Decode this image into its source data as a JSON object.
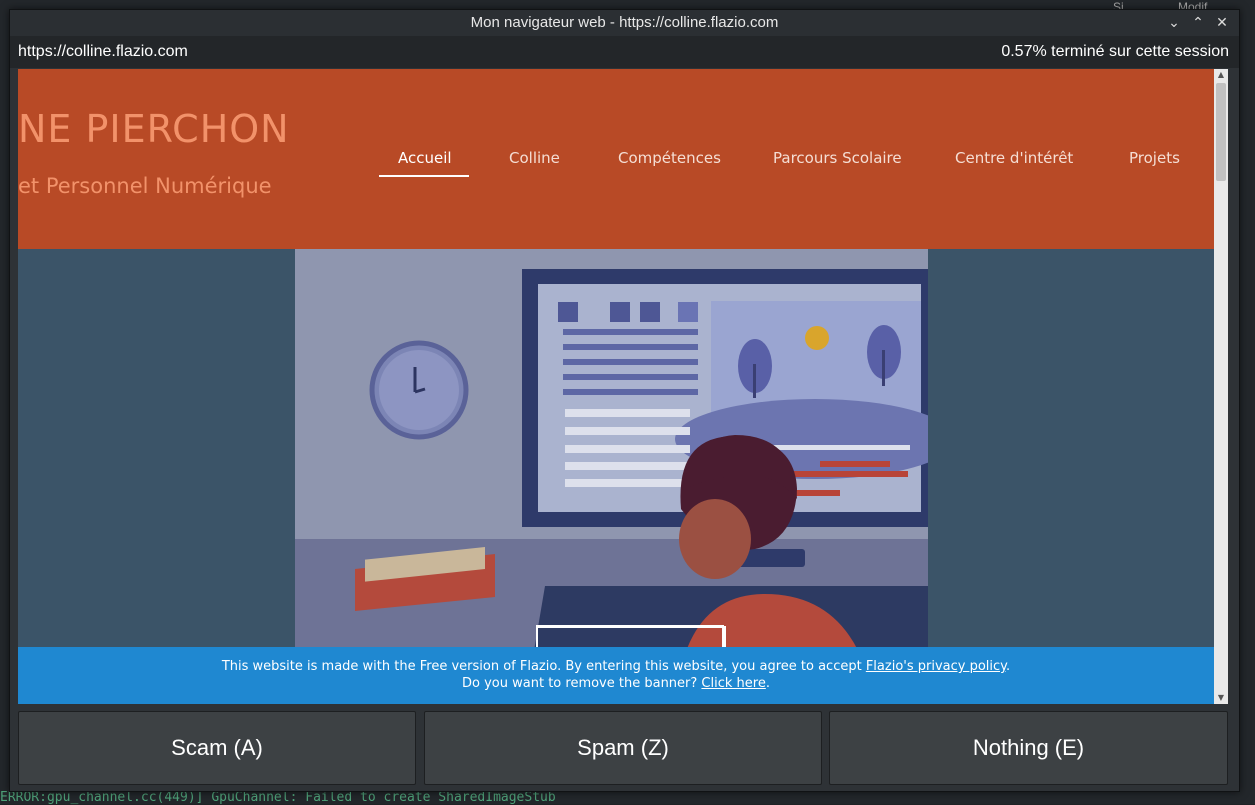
{
  "background": {
    "terminal_lines": [
      "ERROR:gpu_channel.cc(449)] GpuChannel: Failed to create SharedImageStub"
    ],
    "top_right": [
      "Si",
      "Modif"
    ]
  },
  "window": {
    "title": "Mon navigateur web - https://colline.flazio.com",
    "controls": {
      "minimize": "⌄",
      "maximize": "⌃",
      "close": "✕"
    }
  },
  "infobar": {
    "url": "https://colline.flazio.com",
    "progress_text": "0.57% terminé sur cette session"
  },
  "site": {
    "title": "NE PIERCHON",
    "subtitle": "et Personnel Numérique",
    "nav": [
      {
        "label": "Accueil",
        "active": true
      },
      {
        "label": "Colline",
        "active": false
      },
      {
        "label": "Compétences",
        "active": false
      },
      {
        "label": "Parcours Scolaire",
        "active": false
      },
      {
        "label": "Centre d'intérêt",
        "active": false
      },
      {
        "label": "Projets",
        "active": false
      }
    ],
    "banner": {
      "line1_text": "This website is made with the Free version of Flazio. By entering this website, you agree to accept ",
      "line1_link": "Flazio's privacy policy",
      "line1_end": ".",
      "line2_text": "Do you want to remove the banner? ",
      "line2_link": "Click here",
      "line2_end": "."
    },
    "colors": {
      "header": "#b84a26",
      "title": "#f2926a",
      "banner": "#1f88d1",
      "page_bg": "#3b5468"
    }
  },
  "actions": [
    {
      "label": "Scam (A)"
    },
    {
      "label": "Spam (Z)"
    },
    {
      "label": "Nothing (E)"
    }
  ]
}
